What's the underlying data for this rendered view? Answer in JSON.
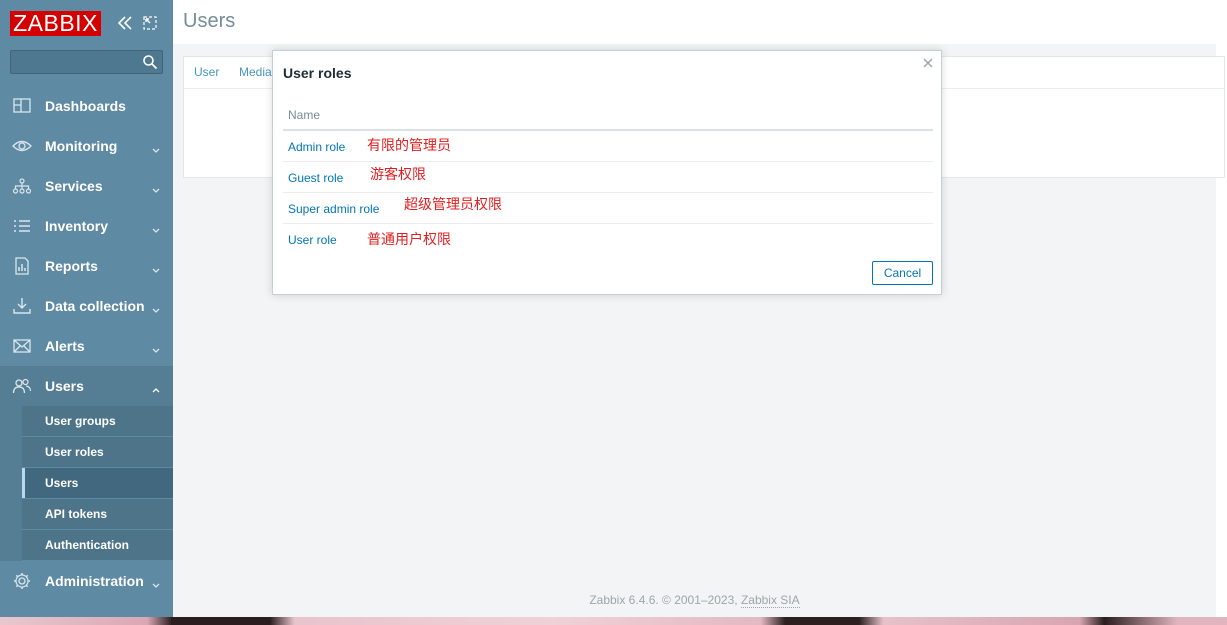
{
  "sidebar": {
    "logo": "ZABBIX",
    "search": {
      "value": "",
      "placeholder": ""
    },
    "menu": [
      {
        "label": "Dashboards",
        "icon": "dashboards-icon"
      },
      {
        "label": "Monitoring",
        "icon": "eye-icon"
      },
      {
        "label": "Services",
        "icon": "services-icon"
      },
      {
        "label": "Inventory",
        "icon": "list-icon"
      },
      {
        "label": "Reports",
        "icon": "reports-icon"
      },
      {
        "label": "Data collection",
        "icon": "download-icon"
      },
      {
        "label": "Alerts",
        "icon": "envelope-icon"
      },
      {
        "label": "Users",
        "icon": "users-icon",
        "expanded": true
      },
      {
        "label": "Administration",
        "icon": "gear-icon"
      }
    ],
    "users_submenu": [
      {
        "label": "User groups"
      },
      {
        "label": "User roles"
      },
      {
        "label": "Users",
        "selected": true
      },
      {
        "label": "API tokens"
      },
      {
        "label": "Authentication"
      }
    ]
  },
  "page": {
    "title": "Users",
    "tabs": [
      "User",
      "Media"
    ]
  },
  "modal": {
    "title": "User roles",
    "column_name": "Name",
    "rows": [
      {
        "role": "Admin role",
        "note": "有限的管理员"
      },
      {
        "role": "Guest role",
        "note": "游客权限"
      },
      {
        "role": "Super admin role",
        "note": "超级管理员权限"
      },
      {
        "role": "User role",
        "note": "普通用户权限"
      }
    ],
    "cancel_label": "Cancel"
  },
  "footer": {
    "text": "Zabbix 6.4.6. © 2001–2023, ",
    "link": "Zabbix SIA"
  },
  "colors": {
    "sidebar": "#5f8aa3",
    "logo": "#d40000",
    "link": "#0275b8",
    "annotation": "#e02020"
  }
}
